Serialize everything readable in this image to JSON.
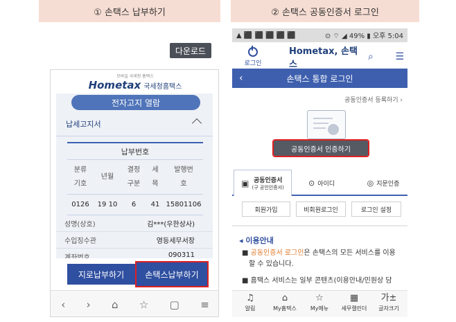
{
  "steps": {
    "left_title": "① 손택스 납부하기",
    "right_title": "② 손택스 공동인증서 로그인"
  },
  "left": {
    "download_label": "다운로드",
    "logo_small": "모바일 국세청 홈택스",
    "logo_main": "Hometax",
    "logo_sub": "국세청홈택스",
    "e_notice": "전자고지 열람",
    "notice_row": "납세고지서",
    "pay_header": "납부번호",
    "columns": [
      "분류\n기호",
      "년월",
      "결정\n구분",
      "세\n목",
      "발행번\n호"
    ],
    "values": [
      "0126",
      "19 10",
      "6",
      "41",
      "15801106"
    ],
    "info": [
      {
        "label": "성명(상호)",
        "value": "김***(우한상사)"
      },
      {
        "label": "수입징수관",
        "value": "영등세무서장"
      },
      {
        "label": "계좌번호",
        "value": "090311"
      }
    ],
    "btn_jiro": "지로납부하기",
    "btn_sontax": "손택스납부하기",
    "nav_icons": [
      "‹",
      "›",
      "⌂",
      "☆",
      "▢",
      "≡"
    ]
  },
  "right": {
    "status_left": "▲ ⬛ ⬛ ⬛ ⬛ ⬛",
    "status_right": "⊙ ⌔ ◢ 49% ▮ 오후 5:04",
    "login_label": "로그인",
    "logo": "Hometax, 손택스",
    "search_icon": "⌕",
    "menu_icon": "☰",
    "bar_title": "손택스 통합 로그인",
    "back": "‹",
    "register_link": "공동인증서 등록하기 ›",
    "cert_button": "공동인증서 인증하기",
    "tab_cert_1": "공동인증서",
    "tab_cert_2": "(구 공인인증서)",
    "tab_id": "아이디",
    "tab_finger": "지문인증",
    "btn_join": "회원가입",
    "btn_nonmember": "비회원로그인",
    "btn_login_settings": "로그인 설정",
    "usage_title": "이용안내",
    "usage_line1_a": "공동인증서 로그인",
    "usage_line1_b": "은 손택스의 모든 서비스를 이용",
    "usage_line2": "할 수 있습니다.",
    "usage_line3": "홈택스 서비스는 일부 콘텐츠(이용안내/민원상 담",
    "bottom": [
      {
        "icon": "♫",
        "label": "알림"
      },
      {
        "icon": "⌂",
        "label": "My홈택스"
      },
      {
        "icon": "☆",
        "label": "My메뉴"
      },
      {
        "icon": "▦",
        "label": "세무캘린더"
      },
      {
        "icon": "가±",
        "label": "글자크기"
      }
    ]
  },
  "colors": {
    "header_bg": "#f6ddd3",
    "primary_blue": "#2f4fa0",
    "highlight_red": "#e02020"
  }
}
